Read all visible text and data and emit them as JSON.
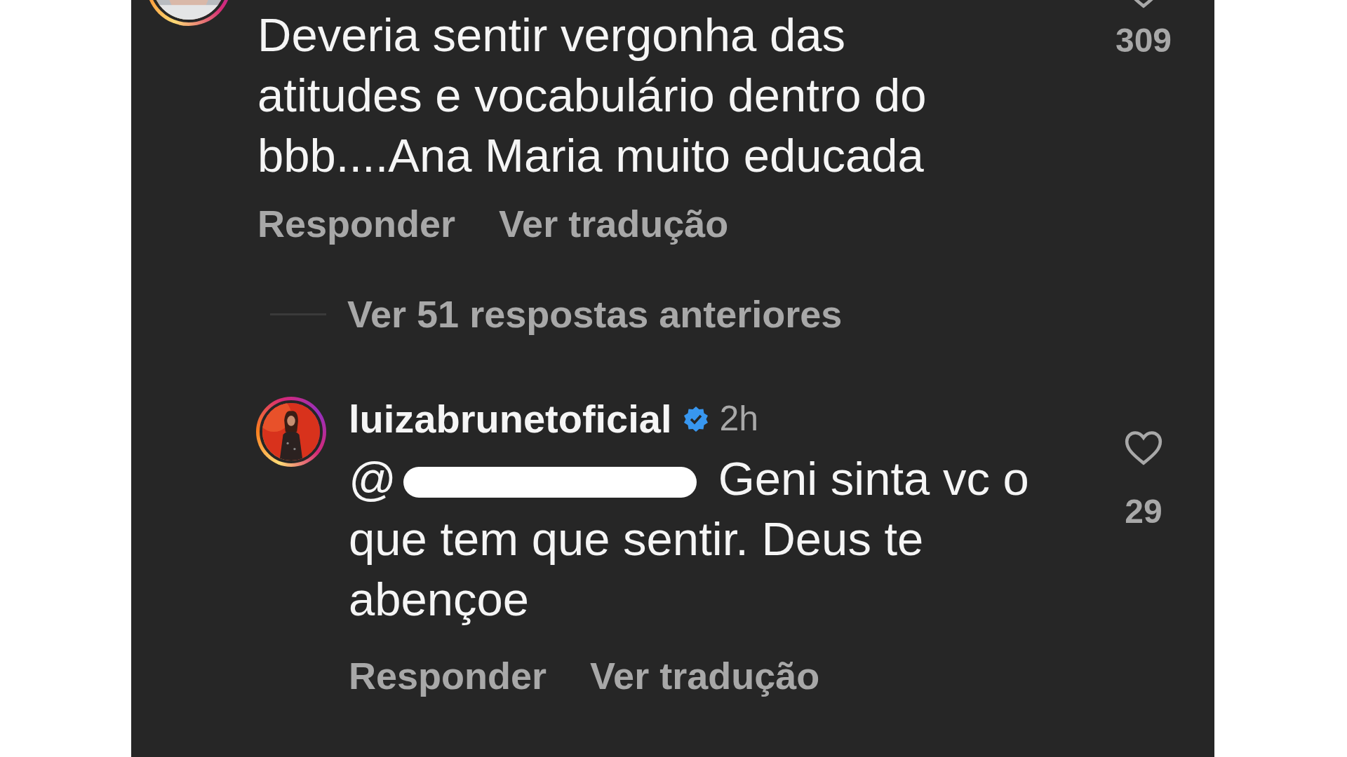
{
  "comments": [
    {
      "kind": "partial",
      "avatar": {
        "kind": "picture",
        "ring": true
      },
      "text": "Deveria sentir vergonha das atitudes e vocabulário dentro do bbb....Ana Maria muito educada",
      "likes": "309",
      "liked": false,
      "actions": [
        "Responder",
        "Ver tradução"
      ]
    },
    {
      "kind": "reply",
      "view_more": "Ver 51 respostas anteriores",
      "avatar": {
        "kind": "picture",
        "ring": true
      },
      "username": "luizabrunetoficial",
      "verified": true,
      "time": "2h",
      "mention": {
        "prefix": "@",
        "redacted": true
      },
      "text": "Geni sinta vc o que tem que sentir. Deus te abençoe",
      "likes": "29",
      "liked": false,
      "actions": [
        "Responder",
        "Ver tradução"
      ]
    }
  ]
}
